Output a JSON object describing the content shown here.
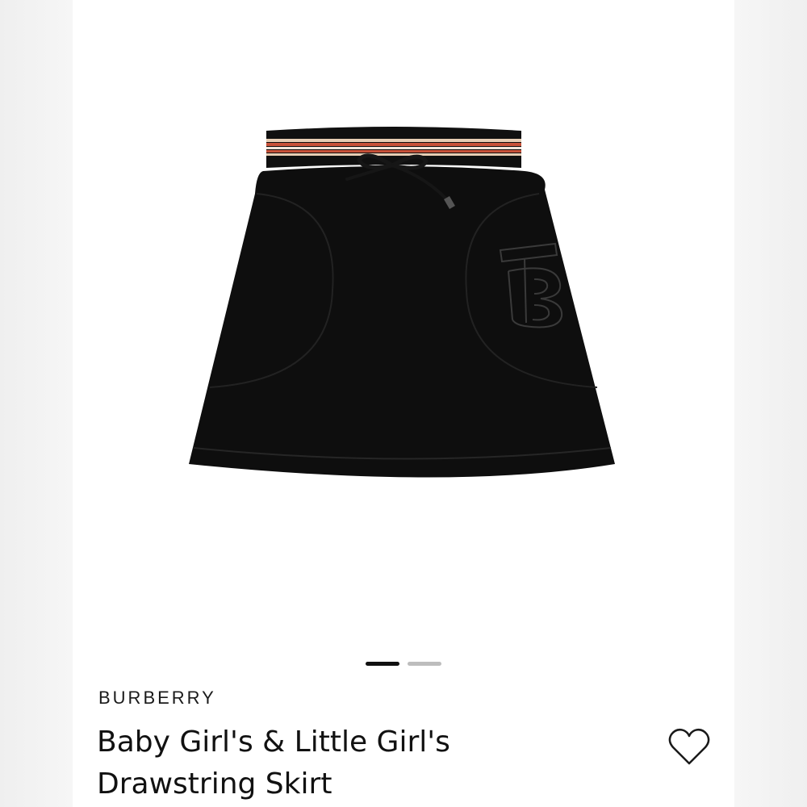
{
  "product": {
    "brand": "BURBERRY",
    "title": "Baby Girl's & Little Girl's Drawstring Skirt",
    "image_icon": "skirt-product-image",
    "monogram_icon": "tb-monogram-icon"
  },
  "carousel": {
    "total": 2,
    "active": 1
  },
  "actions": {
    "wishlist_icon": "heart-outline-icon"
  },
  "colors": {
    "skirt": "#0e0e0e",
    "stripe_red": "#c8523a",
    "stripe_beige": "#e7cdb4",
    "accent": "#111111"
  }
}
